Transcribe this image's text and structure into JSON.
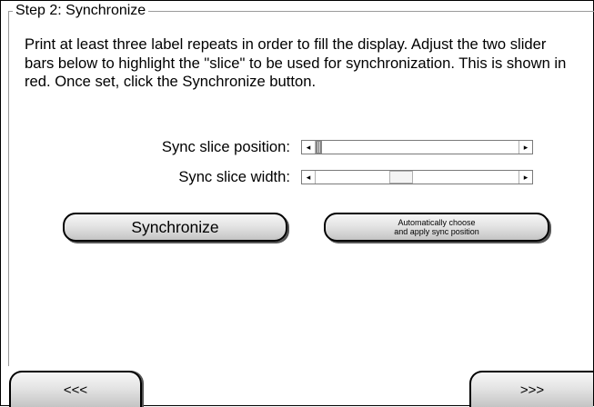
{
  "step": {
    "title": "Step 2: Synchronize",
    "instructions": "Print at least three label repeats in order to fill the display. Adjust the two slider bars below to highlight the \"slice\" to be used for synchronization.  This is shown in red.  Once set, click the Synchronize button."
  },
  "sliders": {
    "position": {
      "label": "Sync slice position:",
      "left_arrow": "◂",
      "right_arrow": "▸",
      "value_fraction": 0.02
    },
    "width": {
      "label": "Sync slice width:",
      "left_arrow": "◂",
      "right_arrow": "▸",
      "value_fraction": 0.42
    }
  },
  "buttons": {
    "synchronize": "Synchronize",
    "auto_line1": "Automatically choose",
    "auto_line2": "and apply sync position",
    "prev": "<<<",
    "next": ">>>"
  }
}
